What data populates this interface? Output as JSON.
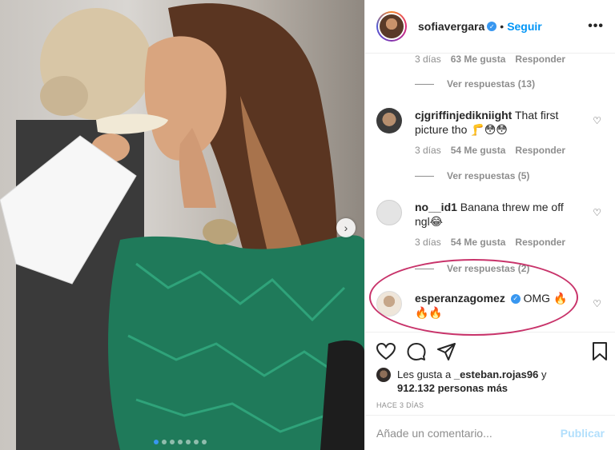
{
  "post": {
    "username": "sofiavergara",
    "separator": "•",
    "follow_label": "Seguir",
    "more_label": "•••"
  },
  "comments": [
    {
      "username": "",
      "text": "",
      "age": "3 días",
      "likes": "63 Me gusta",
      "reply_label": "Responder",
      "view_replies": "Ver respuestas (13)"
    },
    {
      "username": "cjgriffinjedikniight",
      "text": "That first picture tho 🦵😳😳",
      "age": "3 días",
      "likes": "54 Me gusta",
      "reply_label": "Responder",
      "view_replies": "Ver respuestas (5)"
    },
    {
      "username": "no__id1",
      "text": "Banana threw me off ngl😂",
      "age": "3 días",
      "likes": "54 Me gusta",
      "reply_label": "Responder",
      "view_replies": "Ver respuestas (2)"
    },
    {
      "username": "esperanzagomez",
      "text": "OMG 🔥🔥🔥"
    }
  ],
  "likes_summary": {
    "prefix": "Les gusta a",
    "user": "_esteban.rojas96",
    "suffix": "y",
    "count": "912.132 personas más"
  },
  "timestamp": "HACE 3 DÍAS",
  "comment_input": {
    "placeholder": "Añade un comentario...",
    "publish_label": "Publicar"
  },
  "colors": {
    "accent": "#0095f6",
    "highlight": "#c8336a",
    "dress": "#1f7a5a"
  },
  "carousel": {
    "slide_count": 7,
    "active_index": 0
  },
  "icons": [
    "verified-icon",
    "more-icon",
    "heart-icon",
    "comment-icon",
    "share-icon",
    "bookmark-icon",
    "chevron-right-icon"
  ]
}
